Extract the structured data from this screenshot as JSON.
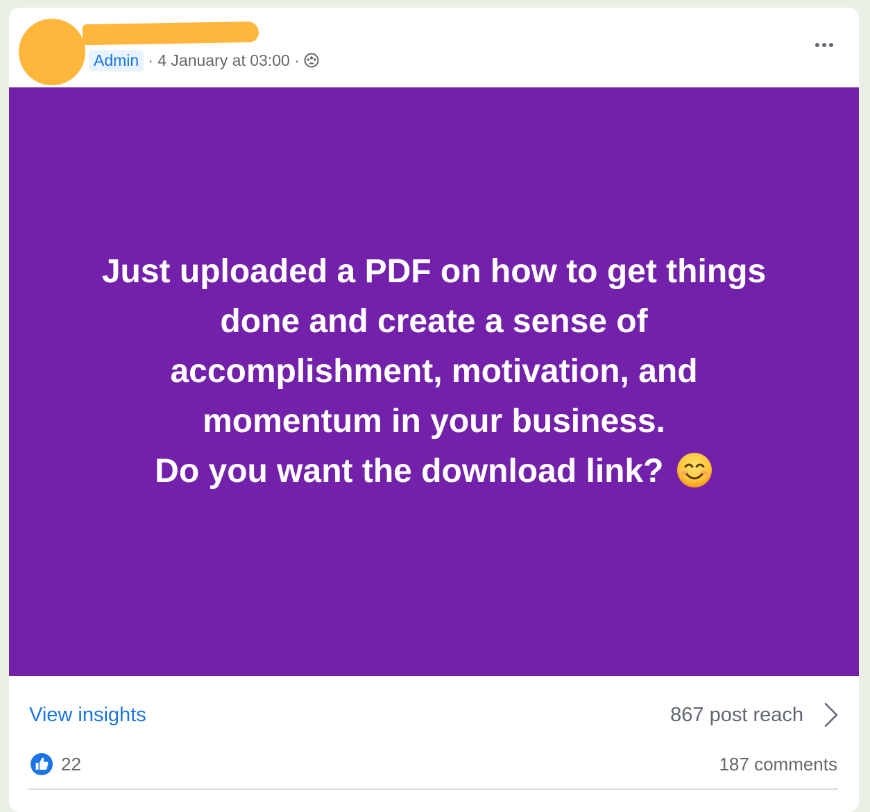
{
  "post": {
    "author_role": "Admin",
    "meta": "· 4 January at 03:00 ·",
    "audience_icon": "group-icon",
    "menu_icon": "more-options-icon",
    "lines": [
      "Just uploaded a PDF on how to get things",
      "done and create a sense of",
      "accomplishment, motivation, and",
      "momentum in your business.",
      "Do you want the download link?"
    ],
    "trailing_emoji": "smiling-face-emoji",
    "background_color": "#7321ab"
  },
  "insights": {
    "link_label": "View insights",
    "reach_label": "867 post reach"
  },
  "engagement": {
    "like_count": "22",
    "comments_label": "187 comments"
  }
}
